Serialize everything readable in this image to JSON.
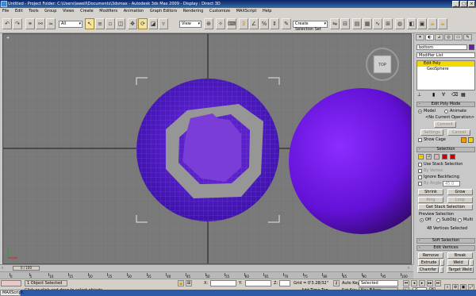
{
  "window": {
    "title": "Untitled   - Project Folder: C:\\Users\\lawell\\Documents\\3dsmax    - Autodesk 3ds Max  2009         - Display : Direct 3D",
    "min": "_",
    "max": "□",
    "close": "×"
  },
  "menu": [
    "File",
    "Edit",
    "Tools",
    "Group",
    "Views",
    "Create",
    "Modifiers",
    "Animation",
    "Graph Editors",
    "Rendering",
    "Customize",
    "MAXScript",
    "Help"
  ],
  "toolbar": {
    "selection_filter": "All",
    "reference_coord": "View",
    "named_selection": "Create Selection Set"
  },
  "viewport": {
    "label": "+",
    "viewcube_label": "TOP",
    "colors": {
      "background": "#7a7a7a",
      "grid": "#6d6d6d",
      "object": "#4a1ab5",
      "accent": "#2a0b7a"
    }
  },
  "panel": {
    "object_name": "bottom",
    "modifier_list": "Modifier List",
    "stack": [
      "Edit Poly",
      "GeoSphere"
    ],
    "edit_poly_mode": {
      "title": "Edit Poly Mode",
      "model": "Model",
      "animate": "Animate",
      "current_op": "<No Current Operation>",
      "commit": "Commit",
      "settings": "Settings",
      "cancel": "Cancel",
      "show_cage": "Show Cage"
    },
    "selection": {
      "title": "Selection",
      "by_vertex": "By Vertex",
      "use_stack": "Use Stack Selection",
      "ignore_backfacing": "Ignore Backfacing",
      "by_angle": "By Angle:",
      "angle_value": "45.0",
      "shrink": "Shrink",
      "grow": "Grow",
      "ring": "Ring",
      "loop": "Loop",
      "get_stack": "Get Stack Selection",
      "preview_title": "Preview Selection",
      "off": "Off",
      "subobj": "SubObj",
      "multi": "Multi",
      "count": "48 Vertices Selected"
    },
    "soft_selection": "Soft Selection",
    "edit_vertices": {
      "title": "Edit Vertices",
      "remove": "Remove",
      "break": "Break",
      "extrude": "Extrude",
      "weld": "Weld",
      "chamfer": "Chamfer",
      "target_weld": "Target Weld"
    }
  },
  "timeline": {
    "frame": "0 / 100",
    "ticks": [
      "0",
      "5",
      "10",
      "15",
      "20",
      "25",
      "30",
      "35",
      "40",
      "45",
      "50",
      "55",
      "60",
      "65",
      "70",
      "75",
      "80",
      "85",
      "90",
      "95",
      "100"
    ]
  },
  "status": {
    "selected_count": "1 Object Selected",
    "prompt": "Click or click-and-drag to select objects",
    "x_label": "X:",
    "y_label": "Y:",
    "z_label": "Z:",
    "grid": "Grid = 0'3.28/32\"",
    "auto_key": "Auto Key",
    "set_key": "Set Key",
    "key_mode": "Selected",
    "key_filters": "Key Filters...",
    "add_time_tag": "Add Time Tag",
    "frame_field": "0",
    "maxscript": "MAXScript."
  }
}
